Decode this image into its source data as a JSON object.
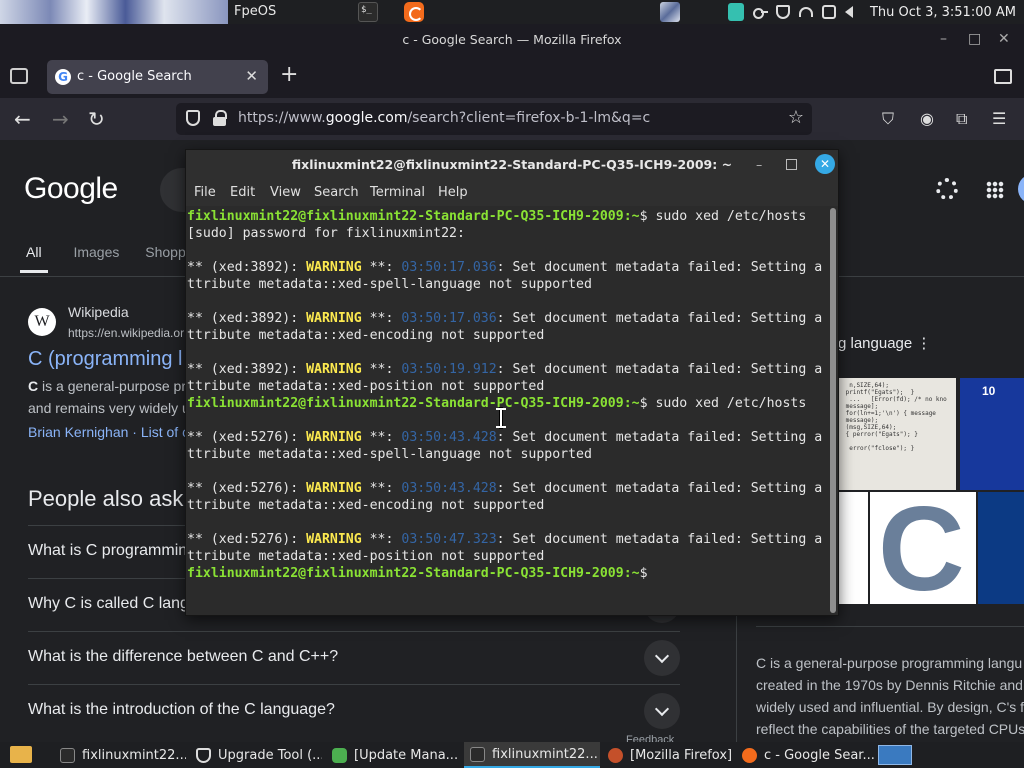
{
  "top_panel": {
    "app_title": "FpeOS",
    "clock": "Thu Oct  3, 3:51:00 AM"
  },
  "firefox": {
    "window_title": "c - Google Search — Mozilla Firefox",
    "tab_label": "c - Google Search",
    "url_prefix": "https://www.",
    "url_host": "google.com",
    "url_rest": "/search?client=firefox-b-1-lm&q=c"
  },
  "google": {
    "logo": "Google",
    "tabs": [
      "All",
      "Images",
      "Shoppin"
    ],
    "result": {
      "source": "Wikipedia",
      "cite": "https://en.wikipedia.or",
      "title": "C (programming l",
      "snippet_bold": "C",
      "snippet_1": " is a general-purpose pr",
      "snippet_2": "and remains very widely u",
      "links": "Brian Kernighan · List of c"
    },
    "paa_title": "People also ask",
    "paa": [
      "What is C programmin",
      "Why C is called C lang",
      "What is the difference between C and C++?",
      "What is the introduction of the C language?"
    ],
    "feedback": "Feedback",
    "kp_title": "g language",
    "kp_image_badge": "10",
    "kp_image_letter": "C",
    "kp_desc": [
      "C is a general-purpose programming langu",
      "created in the 1970s by Dennis Ritchie and",
      "widely used and influential. By design, C's f",
      "reflect the capabilities of the targeted CPUs"
    ]
  },
  "terminal": {
    "title": "fixlinuxmint22@fixlinuxmint22-Standard-PC-Q35-ICH9-2009: ~",
    "menu": [
      "File",
      "Edit",
      "View",
      "Search",
      "Terminal",
      "Help"
    ],
    "prompt": "fixlinuxmint22@fixlinuxmint22-Standard-PC-Q35-ICH9-2009",
    "cwd": ":~",
    "lines": [
      {
        "type": "cmd",
        "cmd": "$ sudo xed /etc/hosts"
      },
      {
        "type": "text",
        "text": "[sudo] password for fixlinuxmint22:"
      },
      {
        "type": "text",
        "text": ""
      },
      {
        "type": "warn",
        "pid": "** (xed:3892): ",
        "ts": "03:50:17.036",
        "msg": ": Set document metadata failed: Setting a"
      },
      {
        "type": "text",
        "text": "ttribute metadata::xed-spell-language not supported"
      },
      {
        "type": "text",
        "text": ""
      },
      {
        "type": "warn",
        "pid": "** (xed:3892): ",
        "ts": "03:50:17.036",
        "msg": ": Set document metadata failed: Setting a"
      },
      {
        "type": "text",
        "text": "ttribute metadata::xed-encoding not supported"
      },
      {
        "type": "text",
        "text": ""
      },
      {
        "type": "warn",
        "pid": "** (xed:3892): ",
        "ts": "03:50:19.912",
        "msg": ": Set document metadata failed: Setting a"
      },
      {
        "type": "text",
        "text": "ttribute metadata::xed-position not supported"
      },
      {
        "type": "cmd",
        "cmd": "$ sudo xed /etc/hosts"
      },
      {
        "type": "text",
        "text": ""
      },
      {
        "type": "warn",
        "pid": "** (xed:5276): ",
        "ts": "03:50:43.428",
        "msg": ": Set document metadata failed: Setting a"
      },
      {
        "type": "text",
        "text": "ttribute metadata::xed-spell-language not supported"
      },
      {
        "type": "text",
        "text": ""
      },
      {
        "type": "warn",
        "pid": "** (xed:5276): ",
        "ts": "03:50:43.428",
        "msg": ": Set document metadata failed: Setting a"
      },
      {
        "type": "text",
        "text": "ttribute metadata::xed-encoding not supported"
      },
      {
        "type": "text",
        "text": ""
      },
      {
        "type": "warn",
        "pid": "** (xed:5276): ",
        "ts": "03:50:47.323",
        "msg": ": Set document metadata failed: Setting a"
      },
      {
        "type": "text",
        "text": "ttribute metadata::xed-position not supported"
      },
      {
        "type": "cmd",
        "cmd": "$ "
      }
    ],
    "warning_word": "WARNING",
    "warning_suffix": " **: "
  },
  "taskbar": {
    "items": [
      {
        "label": "fixlinuxmint22...",
        "icon": "terminal-icon",
        "active": false
      },
      {
        "label": "Upgrade Tool (...",
        "icon": "shield-icon",
        "active": false
      },
      {
        "label": "[Update Mana...",
        "icon": "update-manager-icon",
        "active": false
      },
      {
        "label": "fixlinuxmint22...",
        "icon": "terminal-icon",
        "active": true
      },
      {
        "label": "[Mozilla Firefox]",
        "icon": "firefox-icon",
        "active": false
      },
      {
        "label": "c - Google Sear...",
        "icon": "firefox-icon",
        "active": false
      }
    ]
  },
  "colors": {
    "prompt_green": "#8ae234",
    "warning_yellow": "#fce94f",
    "timestamp_blue": "#3465a4",
    "link_blue": "#8ab4f8",
    "close_button_blue": "#35a9e5"
  }
}
